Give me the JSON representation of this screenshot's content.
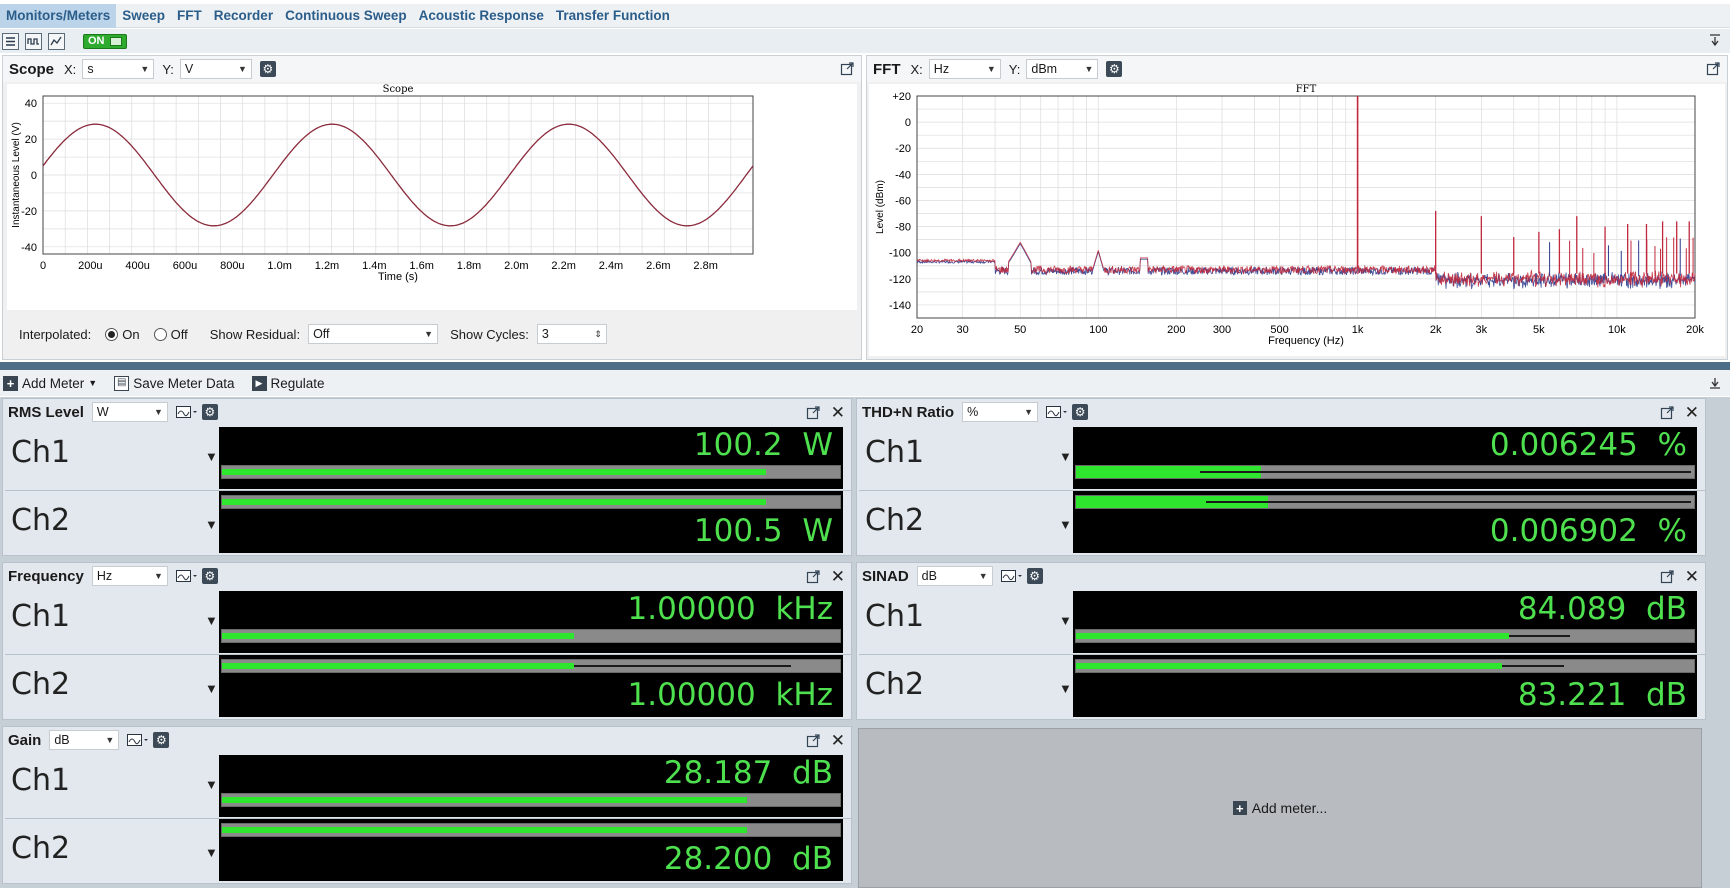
{
  "tabs": [
    "Monitors/Meters",
    "Sweep",
    "FFT",
    "Recorder",
    "Continuous Sweep",
    "Acoustic Response",
    "Transfer Function"
  ],
  "toolbar": {
    "on_label": "ON"
  },
  "scope": {
    "title": "Scope",
    "x_label": "X:",
    "x_unit": "s",
    "y_label": "Y:",
    "y_unit": "V",
    "interpolated_label": "Interpolated:",
    "on_label": "On",
    "off_label": "Off",
    "show_residual_label": "Show Residual:",
    "show_residual_value": "Off",
    "show_cycles_label": "Show Cycles:",
    "show_cycles_value": "3"
  },
  "fft": {
    "title": "FFT",
    "x_label": "X:",
    "x_unit": "Hz",
    "y_label": "Y:",
    "y_unit": "dBm"
  },
  "chart_data": [
    {
      "type": "line",
      "title": "Scope",
      "xlabel": "Time (s)",
      "ylabel": "Instantaneous Level (V)",
      "xlim": [
        0,
        0.003
      ],
      "ylim": [
        -44,
        44
      ],
      "x_ticks": [
        "0",
        "200u",
        "400u",
        "600u",
        "800u",
        "1.0m",
        "1.2m",
        "1.4m",
        "1.6m",
        "1.8m",
        "2.0m",
        "2.2m",
        "2.4m",
        "2.6m",
        "2.8m"
      ],
      "y_ticks": [
        "40",
        "20",
        "0",
        "-20",
        "-40"
      ],
      "series": [
        {
          "frequency_hz": 1000,
          "amplitude_v": 28.3,
          "color": "#8b2a3c"
        }
      ],
      "grid": true
    },
    {
      "type": "line",
      "title": "FFT",
      "xlabel": "Frequency (Hz)",
      "ylabel": "Level (dBm)",
      "x_scale": "log",
      "xlim": [
        20,
        20000
      ],
      "ylim": [
        -150,
        20
      ],
      "x_ticks": [
        "20",
        "30",
        "50",
        "100",
        "200",
        "300",
        "500",
        "1k",
        "2k",
        "3k",
        "5k",
        "10k",
        "20k"
      ],
      "y_ticks": [
        "+20",
        "0",
        "-20",
        "-40",
        "-60",
        "-80",
        "-100",
        "-120",
        "-140"
      ],
      "fundamental": {
        "freq": 1000,
        "level": 20
      },
      "harmonics": [
        {
          "freq": 2000,
          "level": -68
        },
        {
          "freq": 3000,
          "level": -72
        },
        {
          "freq": 4000,
          "level": -88
        },
        {
          "freq": 5000,
          "level": -84
        },
        {
          "freq": 6000,
          "level": -82
        },
        {
          "freq": 7000,
          "level": -72
        },
        {
          "freq": 9000,
          "level": -80
        },
        {
          "freq": 11000,
          "level": -78
        },
        {
          "freq": 13000,
          "level": -78
        },
        {
          "freq": 15000,
          "level": -76
        },
        {
          "freq": 17000,
          "level": -76
        },
        {
          "freq": 19000,
          "level": -76
        }
      ],
      "noise_floor": -112,
      "series_colors": [
        "#c0283c",
        "#2a3a8c"
      ],
      "grid": true
    }
  ],
  "meterbar": {
    "add_meter": "Add Meter",
    "save_meter_data": "Save Meter Data",
    "regulate": "Regulate"
  },
  "meters": {
    "rms": {
      "title": "RMS Level",
      "unit": "W",
      "ch1": {
        "label": "Ch1",
        "value": "100.2",
        "unit": "W",
        "level": 0.88
      },
      "ch2": {
        "label": "Ch2",
        "value": "100.5",
        "unit": "W",
        "level": 0.88
      }
    },
    "thdn": {
      "title": "THD+N Ratio",
      "unit": "%",
      "ch1": {
        "label": "Ch1",
        "value": "0.006245",
        "unit": "%",
        "level": 0.3,
        "sub": 0.2
      },
      "ch2": {
        "label": "Ch2",
        "value": "0.006902",
        "unit": "%",
        "level": 0.31,
        "sub": 0.21
      }
    },
    "freq": {
      "title": "Frequency",
      "unit": "Hz",
      "ch1": {
        "label": "Ch1",
        "value": "1.00000",
        "unit": "kHz",
        "level": 0.57
      },
      "ch2": {
        "label": "Ch2",
        "value": "1.00000",
        "unit": "kHz",
        "level": 0.57,
        "peak": 0.92
      }
    },
    "sinad": {
      "title": "SINAD",
      "unit": "dB",
      "ch1": {
        "label": "Ch1",
        "value": "84.089",
        "unit": "dB",
        "level": 0.7,
        "peak": 0.8
      },
      "ch2": {
        "label": "Ch2",
        "value": "83.221",
        "unit": "dB",
        "level": 0.69,
        "peak": 0.79
      }
    },
    "gain": {
      "title": "Gain",
      "unit": "dB",
      "ch1": {
        "label": "Ch1",
        "value": "28.187",
        "unit": "dB",
        "level": 0.85
      },
      "ch2": {
        "label": "Ch2",
        "value": "28.200",
        "unit": "dB",
        "level": 0.85
      }
    }
  },
  "add_meter_panel": {
    "label": "Add meter..."
  }
}
